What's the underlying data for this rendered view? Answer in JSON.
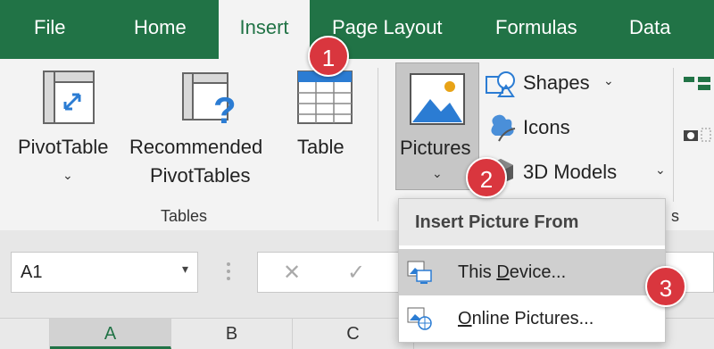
{
  "tabs": [
    {
      "label": "File",
      "active": false
    },
    {
      "label": "Home",
      "active": false
    },
    {
      "label": "Insert",
      "active": true
    },
    {
      "label": "Page Layout",
      "active": false
    },
    {
      "label": "Formulas",
      "active": false
    },
    {
      "label": "Data",
      "active": false
    }
  ],
  "ribbon": {
    "pivot_label": "PivotTable",
    "recommended_line1": "Recommended",
    "recommended_line2": "PivotTables",
    "table_label": "Table",
    "tables_group": "Tables",
    "pictures_label": "Pictures",
    "shapes_label": "Shapes",
    "icons_label": "Icons",
    "models_label": "3D Models",
    "group_tail": "s"
  },
  "dropdown": {
    "header": "Insert Picture From",
    "items": [
      {
        "label": "This Device...",
        "underline_char": "D"
      },
      {
        "label": "Online Pictures...",
        "underline_char": "O"
      }
    ]
  },
  "formula_bar": {
    "name_box": "A1"
  },
  "columns": [
    "A",
    "B",
    "C"
  ],
  "badges": [
    "1",
    "2",
    "3"
  ],
  "colors": {
    "accent": "#217346",
    "badge": "#d9363e",
    "selected_button": "#c6c6c6"
  }
}
